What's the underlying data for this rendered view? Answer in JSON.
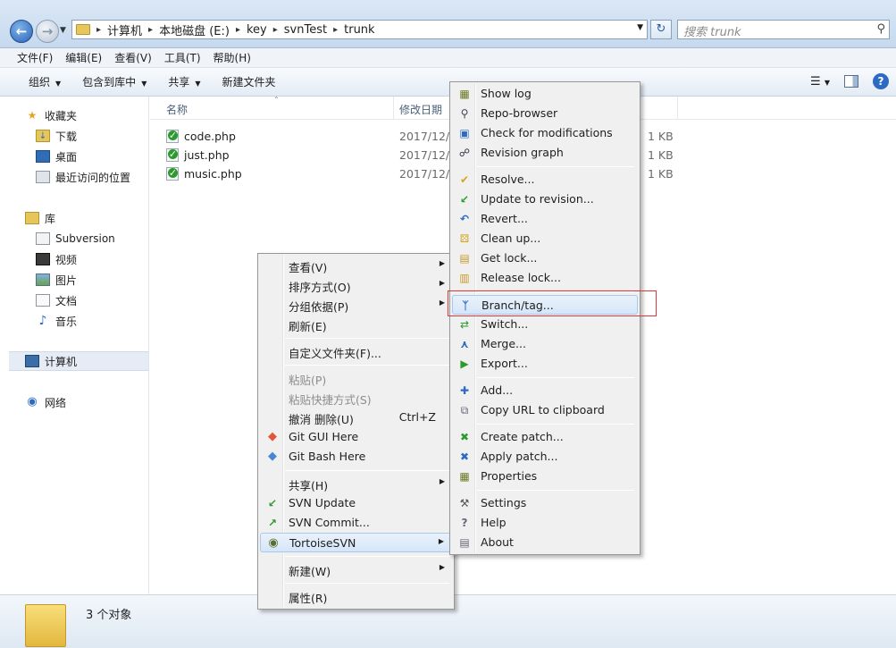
{
  "address": {
    "crumbs": [
      "计算机",
      "本地磁盘 (E:)",
      "key",
      "svnTest",
      "trunk"
    ]
  },
  "search": {
    "placeholder": "搜索 trunk"
  },
  "menubar": [
    "文件(F)",
    "编辑(E)",
    "查看(V)",
    "工具(T)",
    "帮助(H)"
  ],
  "toolbar": {
    "organize": "组织",
    "include_in_library": "包含到库中",
    "share": "共享",
    "new_folder": "新建文件夹"
  },
  "sidebar": {
    "favorites": "收藏夹",
    "downloads": "下载",
    "desktop": "桌面",
    "recent": "最近访问的位置",
    "libraries": "库",
    "subversion": "Subversion",
    "videos": "视频",
    "pictures": "图片",
    "documents": "文档",
    "music": "音乐",
    "computer": "计算机",
    "network": "网络"
  },
  "columns": {
    "name": "名称",
    "modified": "修改日期"
  },
  "files": [
    {
      "name": "code.php",
      "date": "2017/12/2",
      "size": "1 KB"
    },
    {
      "name": "just.php",
      "date": "2017/12/2",
      "size": "1 KB"
    },
    {
      "name": "music.php",
      "date": "2017/12/2",
      "size": "1 KB"
    }
  ],
  "status": {
    "count": "3 个对象"
  },
  "context_menu": {
    "view": "查看(V)",
    "sort_by": "排序方式(O)",
    "group_by": "分组依据(P)",
    "refresh": "刷新(E)",
    "customize_folder": "自定义文件夹(F)...",
    "paste": "粘贴(P)",
    "paste_shortcut": "粘贴快捷方式(S)",
    "undo_delete": "撤消 删除(U)",
    "undo_shortcut": "Ctrl+Z",
    "git_gui": "Git GUI Here",
    "git_bash": "Git Bash Here",
    "share": "共享(H)",
    "svn_update": "SVN Update",
    "svn_commit": "SVN Commit...",
    "tortoisesvn": "TortoiseSVN",
    "new": "新建(W)",
    "properties": "属性(R)"
  },
  "svn_menu": {
    "show_log": "Show log",
    "repo_browser": "Repo-browser",
    "check_modifications": "Check for modifications",
    "revision_graph": "Revision graph",
    "resolve": "Resolve...",
    "update_to_revision": "Update to revision...",
    "revert": "Revert...",
    "clean_up": "Clean up...",
    "get_lock": "Get lock...",
    "release_lock": "Release lock...",
    "branch_tag": "Branch/tag...",
    "switch": "Switch...",
    "merge": "Merge...",
    "export": "Export...",
    "add": "Add...",
    "copy_url": "Copy URL to clipboard",
    "create_patch": "Create patch...",
    "apply_patch": "Apply patch...",
    "properties": "Properties",
    "settings": "Settings",
    "help": "Help",
    "about": "About"
  },
  "colors": {
    "highlight_box": "#d9363e",
    "accent": "#2c6bc3"
  }
}
